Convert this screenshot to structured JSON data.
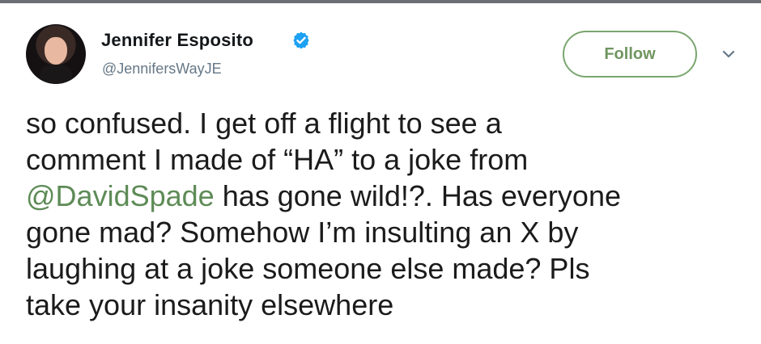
{
  "tweet": {
    "author": {
      "name": "Jennifer Esposito",
      "handle": "@JennifersWayJE",
      "verified": true
    },
    "follow_label": "Follow",
    "menu_icon": "chevron-down-icon",
    "text_lines": {
      "line1": "so confused. I get off a flight to see a",
      "line2": "comment I made of “HA” to a joke from",
      "line3_mention": "@DavidSpade",
      "line3_rest": " has gone wild!?. Has everyone",
      "line4": "gone mad? Somehow I’m insulting an X by",
      "line5": "laughing at a joke someone else made? Pls",
      "line6": "take your insanity elsewhere"
    },
    "colors": {
      "mention": "#5e8b57",
      "follow_border": "#7aa66f",
      "verified": "#1da1f2",
      "top_border": "#6b6f73"
    }
  }
}
